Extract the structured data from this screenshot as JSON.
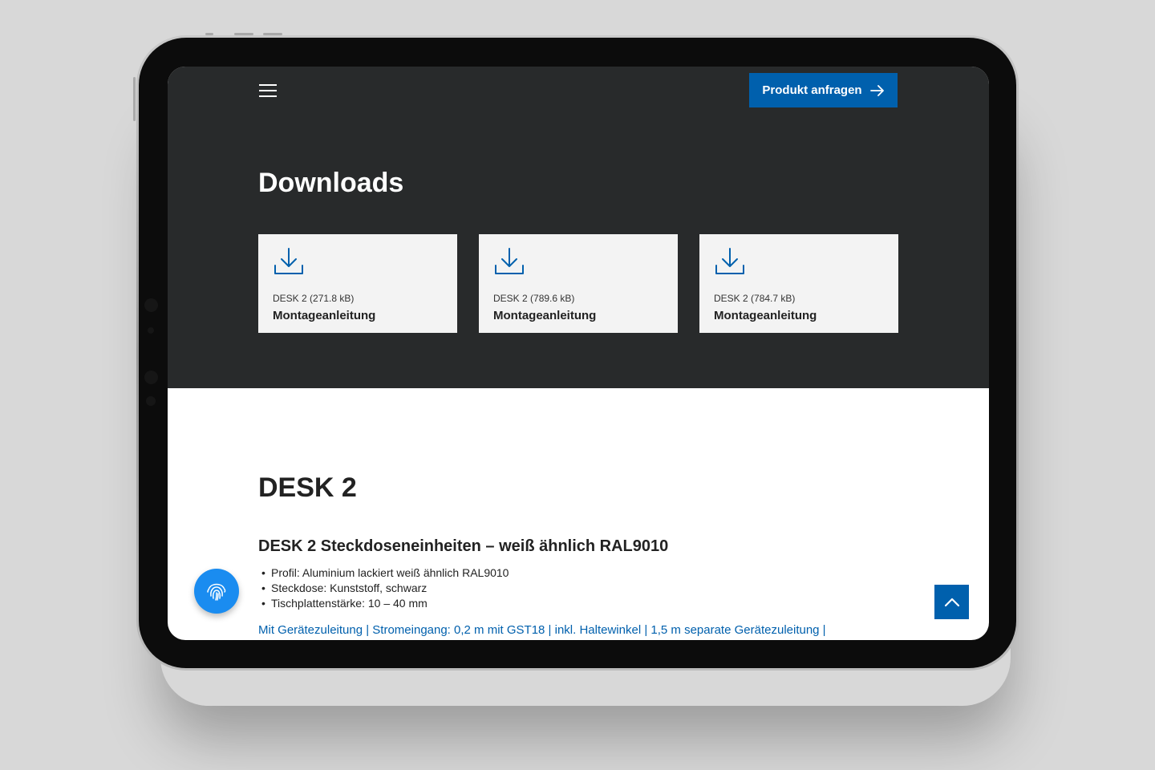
{
  "header": {
    "menu_icon": "hamburger-menu-icon",
    "cta_label": "Produkt anfragen",
    "cta_icon": "arrow-right-icon"
  },
  "downloads": {
    "title": "Downloads",
    "items": [
      {
        "meta": "DESK 2 (271.8 kB)",
        "label": "Montageanleitung",
        "icon": "download-icon"
      },
      {
        "meta": "DESK 2 (789.6 kB)",
        "label": "Montageanleitung",
        "icon": "download-icon"
      },
      {
        "meta": "DESK 2 (784.7 kB)",
        "label": "Montageanleitung",
        "icon": "download-icon"
      }
    ]
  },
  "product": {
    "title": "DESK 2",
    "subtitle": "DESK 2 Steckdoseneinheiten – weiß ähnlich RAL9010",
    "features": [
      "Profil: Aluminium lackiert weiß ähnlich RAL9010",
      "Steckdose: Kunststoff, schwarz",
      "Tischplattenstärke: 10 – 40 mm"
    ],
    "link_line": "Mit Gerätezuleitung | Stromeingang: 0,2 m mit GST18 | inkl. Haltewinkel | 1,5 m separate Gerätezuleitung |"
  },
  "floating": {
    "privacy_icon": "fingerprint-icon",
    "scroll_top_icon": "chevron-up-icon"
  },
  "colors": {
    "brand_blue": "#0060ad",
    "dark_section": "#282a2b",
    "card_bg": "#f3f3f3",
    "fab_blue": "#1a8cf0"
  }
}
